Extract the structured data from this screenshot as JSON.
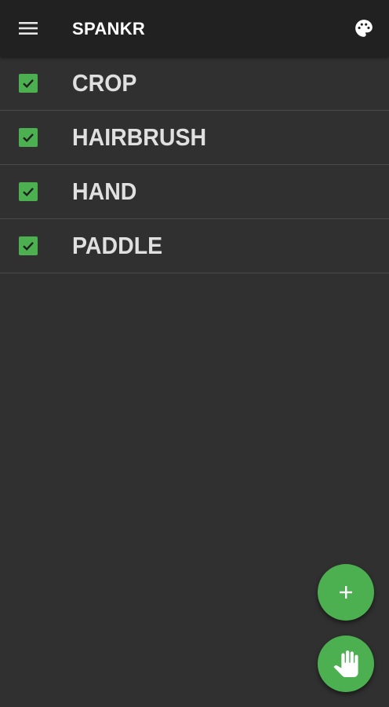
{
  "app_bar": {
    "title": "SPANKR",
    "menu_icon": "menu-icon",
    "palette_icon": "palette-icon",
    "background": "#212121"
  },
  "items": [
    {
      "label": "CROP",
      "checked": true
    },
    {
      "label": "HAIRBRUSH",
      "checked": true
    },
    {
      "label": "HAND",
      "checked": true
    },
    {
      "label": "PADDLE",
      "checked": true
    }
  ],
  "fabs": {
    "add_icon": "plus-icon",
    "hand_icon": "hand-icon"
  },
  "colors": {
    "accent": "#4caf50",
    "background": "#303030",
    "text": "#e0e0e0"
  }
}
